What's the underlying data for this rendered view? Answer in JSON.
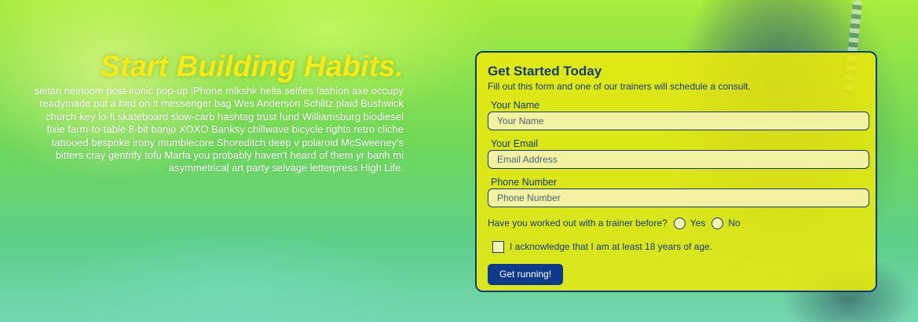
{
  "hero": {
    "title": "Start Building Habits.",
    "body": "seitan heirloom post-ironic pop-up iPhone mlkshk hella selfies fashion axe occupy readymade put a bird on it messenger bag Wes Anderson Schlitz plaid Bushwick church-key lo-fi skateboard slow-carb hashtag trust fund Williamsburg biodiesel fixie farm-to-table 8-bit banjo XOXO Banksy chillwave bicycle rights retro cliche tattooed bespoke irony mumblecore Shoreditch deep v polaroid McSweeney's bitters cray gentrify tofu Marfa you probably haven't heard of them yr banh mi asymmetrical art party selvage letterpress High Life."
  },
  "form": {
    "title": "Get Started Today",
    "subtitle": "Fill out this form and one of our trainers will schedule a consult.",
    "name": {
      "label": "Your Name",
      "placeholder": "Your Name",
      "value": ""
    },
    "email": {
      "label": "Your Email",
      "placeholder": "Email Address",
      "value": ""
    },
    "phone": {
      "label": "Phone Number",
      "placeholder": "Phone Number",
      "value": ""
    },
    "trainer_question": {
      "label": "Have you worked out with a trainer before?",
      "yes_label": "Yes",
      "no_label": "No",
      "selected": null
    },
    "age_ack": {
      "label": "I acknowledge that I am at least 18 years of age.",
      "checked": false
    },
    "submit_label": "Get running!"
  },
  "colors": {
    "accent_yellow": "#f5ea1a",
    "card_bg": "#e9e80e",
    "navy": "#173a7a",
    "button_bg": "#0f3a8a"
  }
}
